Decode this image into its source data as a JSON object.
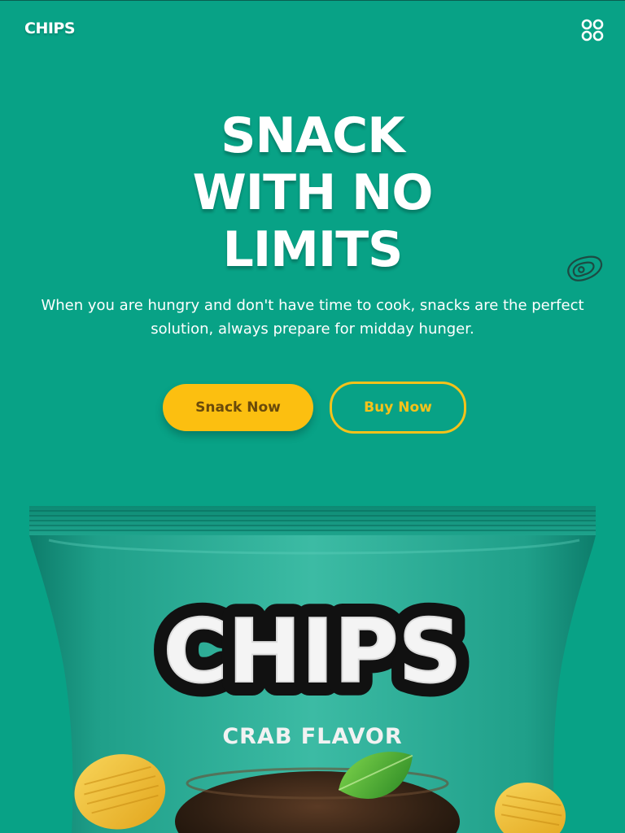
{
  "header": {
    "logo": "CHIPS",
    "menu_icon": "grid-circles-icon"
  },
  "hero": {
    "title_lines": [
      "SNACK",
      "WITH NO",
      "LIMITS"
    ],
    "subtitle": "When you are hungry and don't have time to cook, snacks are the perfect solution, always prepare for midday hunger.",
    "decor_icon": "meat-steak-icon"
  },
  "actions": {
    "primary_label": "Snack Now",
    "secondary_label": "Buy Now"
  },
  "product": {
    "brand": "CHIPS",
    "flavor": "CRAB FLAVOR"
  },
  "colors": {
    "background": "#08a286",
    "accent_yellow": "#fcbf10",
    "bag_teal": "#23a893",
    "white": "#ffffff"
  }
}
